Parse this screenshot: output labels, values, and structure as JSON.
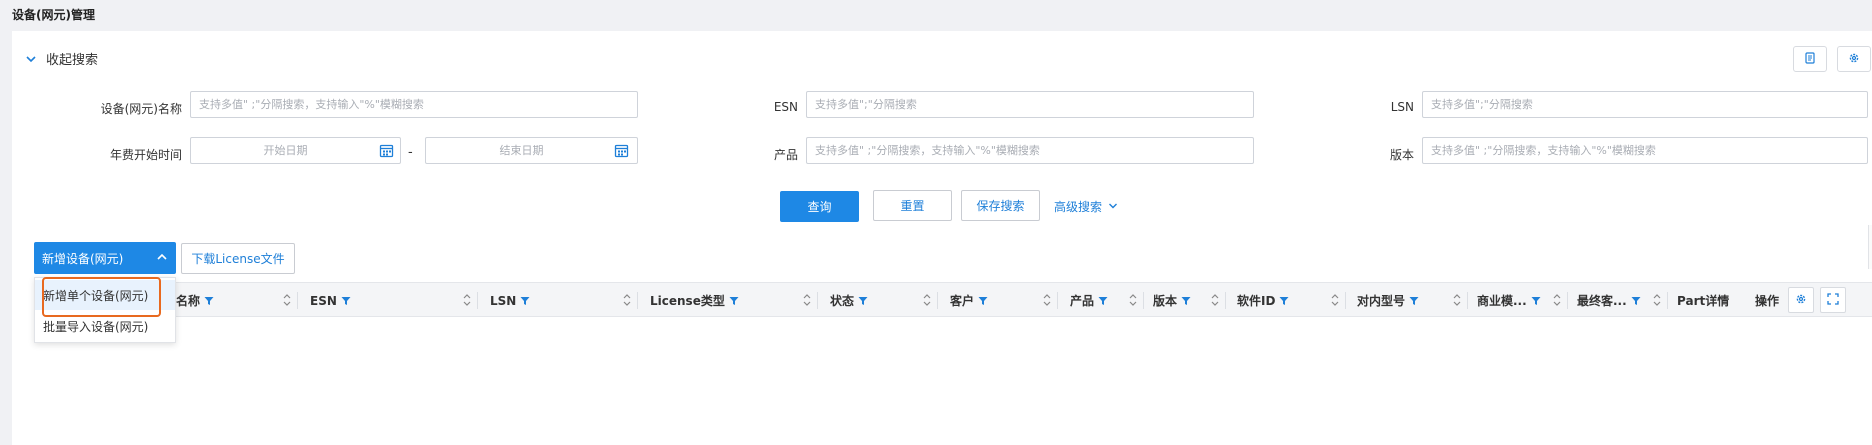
{
  "page": {
    "title": "设备(网元)管理"
  },
  "search": {
    "collapse_label": "收起搜索",
    "fields": {
      "name": {
        "label": "设备(网元)名称",
        "placeholder": "支持多值\" ;\"分隔搜索，支持输入\"%\"模糊搜索"
      },
      "esn": {
        "label": "ESN",
        "placeholder": "支持多值\";\"分隔搜索"
      },
      "lsn": {
        "label": "LSN",
        "placeholder": "支持多值\";\"分隔搜索"
      },
      "fee_start": {
        "label": "年费开始时间",
        "start_placeholder": "开始日期",
        "end_placeholder": "结束日期",
        "separator": "-"
      },
      "product": {
        "label": "产品",
        "placeholder": "支持多值\" ;\"分隔搜索，支持输入\"%\"模糊搜索"
      },
      "version": {
        "label": "版本",
        "placeholder": "支持多值\" ;\"分隔搜索，支持输入\"%\"模糊搜索"
      }
    },
    "buttons": {
      "query": "查询",
      "reset": "重置",
      "save": "保存搜索",
      "advanced": "高级搜索"
    }
  },
  "toolbar": {
    "add_label": "新增设备(网元)",
    "download_label": "下载License文件",
    "add_menu": [
      {
        "label": "新增单个设备(网元)"
      },
      {
        "label": "批量导入设备(网元)"
      }
    ]
  },
  "table": {
    "columns": [
      {
        "label": "名称"
      },
      {
        "label": "ESN"
      },
      {
        "label": "LSN"
      },
      {
        "label": "License类型"
      },
      {
        "label": "状态"
      },
      {
        "label": "客户"
      },
      {
        "label": "产品"
      },
      {
        "label": "版本"
      },
      {
        "label": "软件ID"
      },
      {
        "label": "对内型号"
      },
      {
        "label": "商业模..."
      },
      {
        "label": "最终客..."
      },
      {
        "label": "Part详情"
      },
      {
        "label": "操作"
      }
    ]
  },
  "colors": {
    "primary": "#1e88e5",
    "link": "#1e7fd8",
    "highlight": "#e8691f"
  }
}
